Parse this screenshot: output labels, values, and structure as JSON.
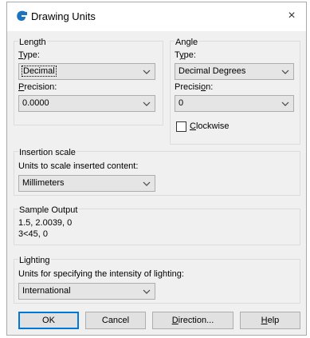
{
  "window": {
    "title": "Drawing Units",
    "close_glyph": "×"
  },
  "length": {
    "group_label": "Length",
    "type_label_u": "T",
    "type_label_rest": "ype:",
    "type_value": "Decimal",
    "precision_label_u": "P",
    "precision_label_rest": "recision:",
    "precision_value": "0.0000"
  },
  "angle": {
    "group_label": "Angle",
    "type_label_pre": "T",
    "type_label_u": "y",
    "type_label_rest": "pe:",
    "type_value": "Decimal Degrees",
    "precision_label_pre": "Precisi",
    "precision_label_u": "o",
    "precision_label_rest": "n:",
    "precision_value": "0",
    "clockwise_u": "C",
    "clockwise_rest": "lockwise",
    "clockwise_checked": false
  },
  "insertion": {
    "group_label": "Insertion scale",
    "description": "Units to scale inserted content:",
    "value": "Millimeters"
  },
  "sample": {
    "group_label": "Sample Output",
    "line1": "1.5, 2.0039, 0",
    "line2": "3<45, 0"
  },
  "lighting": {
    "group_label": "Lighting",
    "description": "Units for specifying the intensity of lighting:",
    "value": "International"
  },
  "buttons": {
    "ok": "OK",
    "cancel": "Cancel",
    "direction_u": "D",
    "direction_rest": "irection...",
    "help_u": "H",
    "help_rest": "elp"
  },
  "icons": {
    "app": "autocad-g-icon",
    "chevron": "chevron-down-icon"
  },
  "colors": {
    "app_icon": "#1e73be",
    "ok_border": "#0078d7"
  }
}
